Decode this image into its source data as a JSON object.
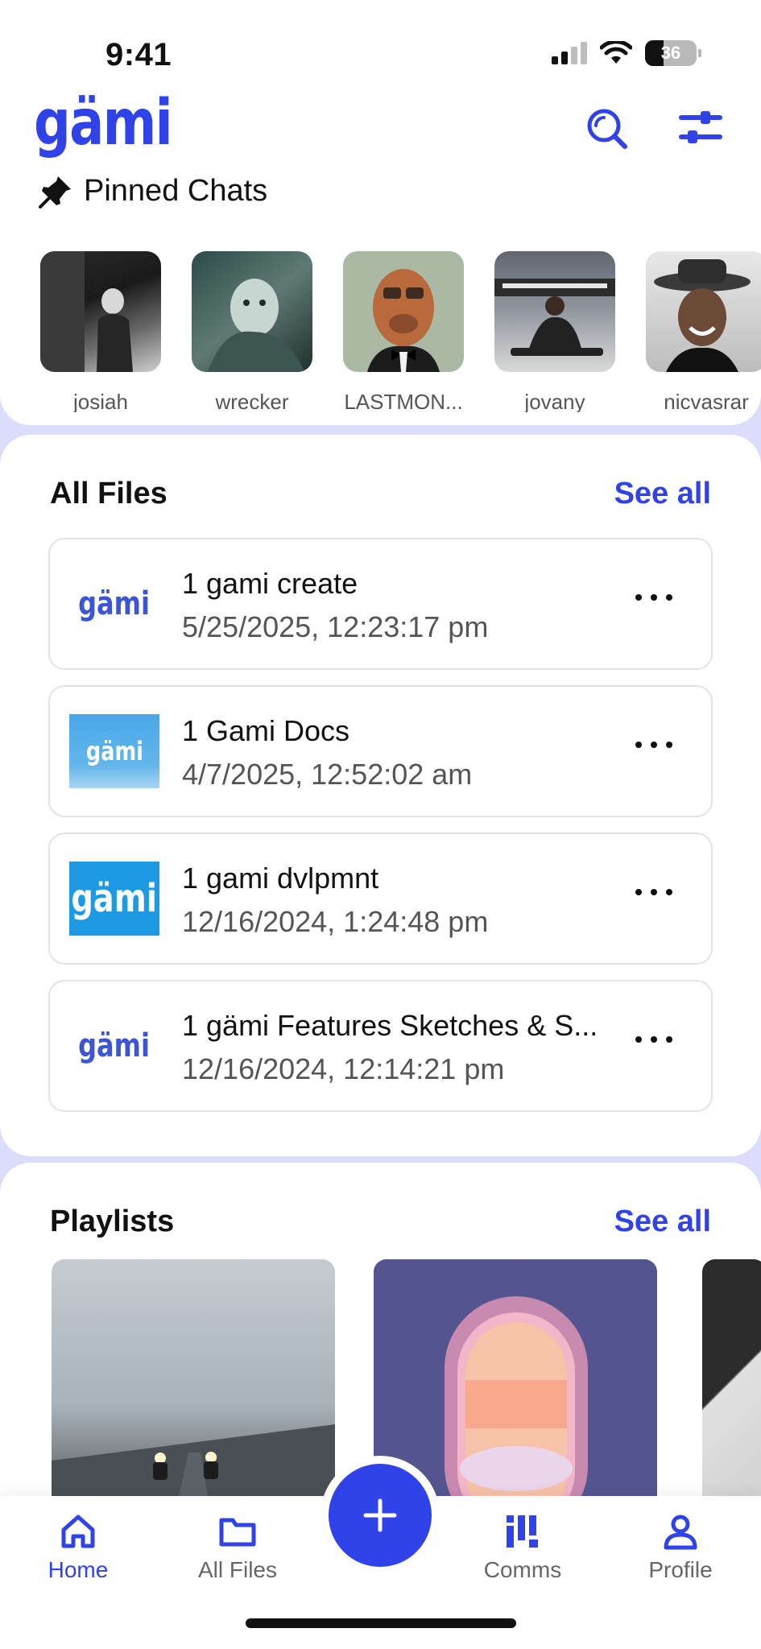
{
  "status": {
    "time": "9:41",
    "battery": "36"
  },
  "app": {
    "logo": "gämi"
  },
  "header": {
    "search_icon": "search-icon",
    "filter_icon": "filter-sliders-icon"
  },
  "pinned": {
    "title": "Pinned Chats",
    "icon": "pin-icon",
    "items": [
      {
        "name": "josiah"
      },
      {
        "name": "wrecker"
      },
      {
        "name": "LASTMON..."
      },
      {
        "name": "jovany"
      },
      {
        "name": "nicvasrar"
      }
    ]
  },
  "files": {
    "title": "All Files",
    "see_all": "See all",
    "items": [
      {
        "name": "1 gami create",
        "date": "5/25/2025, 12:23:17 pm",
        "thumb_text": "gämi"
      },
      {
        "name": "1 Gami Docs",
        "date": "4/7/2025, 12:52:02 am",
        "thumb_text": "gämi"
      },
      {
        "name": "1 gami dvlpmnt",
        "date": "12/16/2024, 1:24:48 pm",
        "thumb_text": "gämi"
      },
      {
        "name": "1 gämi Features Sketches & S...",
        "date": "12/16/2024, 12:14:21 pm",
        "thumb_text": "gämi"
      }
    ]
  },
  "playlists": {
    "title": "Playlists",
    "see_all": "See all"
  },
  "nav": {
    "items": [
      {
        "label": "Home",
        "icon": "home-icon",
        "active": true
      },
      {
        "label": "All Files",
        "icon": "folder-icon",
        "active": false
      },
      {
        "label": "Comms",
        "icon": "comms-icon",
        "active": false
      },
      {
        "label": "Profile",
        "icon": "profile-icon",
        "active": false
      }
    ],
    "fab_icon": "plus-icon"
  },
  "colors": {
    "accent": "#2f43e8",
    "background": "#dcdcfb"
  }
}
